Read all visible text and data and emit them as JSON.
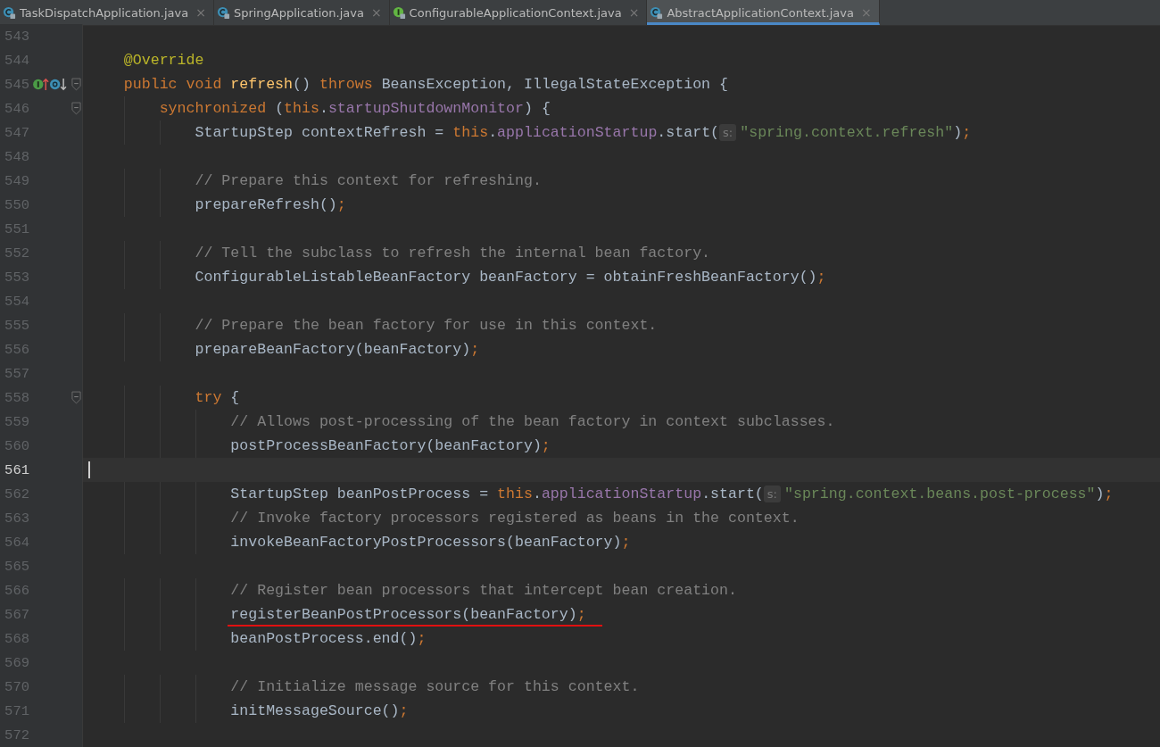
{
  "tabs": [
    {
      "label": "TaskDispatchApplication.java",
      "kind": "class",
      "selected": false
    },
    {
      "label": "SpringApplication.java",
      "kind": "class",
      "selected": false
    },
    {
      "label": "ConfigurableApplicationContext.java",
      "kind": "interface",
      "selected": false
    },
    {
      "label": "AbstractApplicationContext.java",
      "kind": "class",
      "selected": true
    }
  ],
  "close_glyph": "×",
  "lines": [
    {
      "number": "543",
      "current": false,
      "fold": false,
      "gutter_marks": false,
      "underlined": false
    },
    {
      "number": "544",
      "tokens": [
        {
          "kind": "annotation",
          "text": "    @Override"
        }
      ],
      "current": false,
      "fold": false,
      "gutter_marks": false,
      "underlined": false
    },
    {
      "number": "545",
      "tokens": [
        {
          "kind": "keyword",
          "text": "    public void "
        },
        {
          "kind": "method",
          "text": "refresh"
        },
        {
          "kind": "plain",
          "text": "() "
        },
        {
          "kind": "keyword",
          "text": "throws "
        },
        {
          "kind": "plain",
          "text": "BeansException, IllegalStateException {"
        }
      ],
      "current": false,
      "fold": true,
      "gutter_marks": true,
      "underlined": false
    },
    {
      "number": "546",
      "tokens": [
        {
          "kind": "keyword",
          "text": "        synchronized "
        },
        {
          "kind": "plain",
          "text": "("
        },
        {
          "kind": "keyword",
          "text": "this"
        },
        {
          "kind": "plain",
          "text": "."
        },
        {
          "kind": "field",
          "text": "startupShutdownMonitor"
        },
        {
          "kind": "plain",
          "text": ") {"
        }
      ],
      "current": false,
      "fold": true,
      "gutter_marks": false,
      "underlined": false
    },
    {
      "number": "547",
      "tokens": [
        {
          "kind": "plain",
          "text": "            StartupStep contextRefresh = "
        },
        {
          "kind": "keyword",
          "text": "this"
        },
        {
          "kind": "plain",
          "text": "."
        },
        {
          "kind": "field",
          "text": "applicationStartup"
        },
        {
          "kind": "plain",
          "text": ".start("
        },
        {
          "kind": "hint",
          "text": "s:"
        },
        {
          "kind": "string",
          "text": "\"spring.context.refresh\""
        },
        {
          "kind": "plain",
          "text": ")"
        },
        {
          "kind": "keyword",
          "text": ";"
        }
      ],
      "current": false,
      "fold": false,
      "gutter_marks": false,
      "underlined": false
    },
    {
      "number": "548",
      "current": false,
      "fold": false,
      "gutter_marks": false,
      "underlined": false
    },
    {
      "number": "549",
      "tokens": [
        {
          "kind": "comment",
          "text": "            // Prepare this context for refreshing."
        }
      ],
      "current": false,
      "fold": false,
      "gutter_marks": false,
      "underlined": false
    },
    {
      "number": "550",
      "tokens": [
        {
          "kind": "plain",
          "text": "            prepareRefresh()"
        },
        {
          "kind": "keyword",
          "text": ";"
        }
      ],
      "current": false,
      "fold": false,
      "gutter_marks": false,
      "underlined": false
    },
    {
      "number": "551",
      "current": false,
      "fold": false,
      "gutter_marks": false,
      "underlined": false
    },
    {
      "number": "552",
      "tokens": [
        {
          "kind": "comment",
          "text": "            // Tell the subclass to refresh the internal bean factory."
        }
      ],
      "current": false,
      "fold": false,
      "gutter_marks": false,
      "underlined": false
    },
    {
      "number": "553",
      "tokens": [
        {
          "kind": "plain",
          "text": "            ConfigurableListableBeanFactory beanFactory = obtainFreshBeanFactory()"
        },
        {
          "kind": "keyword",
          "text": ";"
        }
      ],
      "current": false,
      "fold": false,
      "gutter_marks": false,
      "underlined": false
    },
    {
      "number": "554",
      "current": false,
      "fold": false,
      "gutter_marks": false,
      "underlined": false
    },
    {
      "number": "555",
      "tokens": [
        {
          "kind": "comment",
          "text": "            // Prepare the bean factory for use in this context."
        }
      ],
      "current": false,
      "fold": false,
      "gutter_marks": false,
      "underlined": false
    },
    {
      "number": "556",
      "tokens": [
        {
          "kind": "plain",
          "text": "            prepareBeanFactory(beanFactory)"
        },
        {
          "kind": "keyword",
          "text": ";"
        }
      ],
      "current": false,
      "fold": false,
      "gutter_marks": false,
      "underlined": false
    },
    {
      "number": "557",
      "current": false,
      "fold": false,
      "gutter_marks": false,
      "underlined": false
    },
    {
      "number": "558",
      "tokens": [
        {
          "kind": "keyword",
          "text": "            try "
        },
        {
          "kind": "plain",
          "text": "{"
        }
      ],
      "current": false,
      "fold": true,
      "gutter_marks": false,
      "underlined": false
    },
    {
      "number": "559",
      "tokens": [
        {
          "kind": "comment",
          "text": "                // Allows post-processing of the bean factory in context subclasses."
        }
      ],
      "current": false,
      "fold": false,
      "gutter_marks": false,
      "underlined": false
    },
    {
      "number": "560",
      "tokens": [
        {
          "kind": "plain",
          "text": "                postProcessBeanFactory(beanFactory)"
        },
        {
          "kind": "keyword",
          "text": ";"
        }
      ],
      "current": false,
      "fold": false,
      "gutter_marks": false,
      "underlined": false
    },
    {
      "number": "561",
      "current": true,
      "fold": false,
      "gutter_marks": false,
      "underlined": false
    },
    {
      "number": "562",
      "tokens": [
        {
          "kind": "plain",
          "text": "                StartupStep beanPostProcess = "
        },
        {
          "kind": "keyword",
          "text": "this"
        },
        {
          "kind": "plain",
          "text": "."
        },
        {
          "kind": "field",
          "text": "applicationStartup"
        },
        {
          "kind": "plain",
          "text": ".start("
        },
        {
          "kind": "hint",
          "text": "s:"
        },
        {
          "kind": "string",
          "text": "\"spring.context.beans.post-process\""
        },
        {
          "kind": "plain",
          "text": ")"
        },
        {
          "kind": "keyword",
          "text": ";"
        }
      ],
      "current": false,
      "fold": false,
      "gutter_marks": false,
      "underlined": false
    },
    {
      "number": "563",
      "tokens": [
        {
          "kind": "comment",
          "text": "                // Invoke factory processors registered as beans in the context."
        }
      ],
      "current": false,
      "fold": false,
      "gutter_marks": false,
      "underlined": false
    },
    {
      "number": "564",
      "tokens": [
        {
          "kind": "plain",
          "text": "                invokeBeanFactoryPostProcessors(beanFactory)"
        },
        {
          "kind": "keyword",
          "text": ";"
        }
      ],
      "current": false,
      "fold": false,
      "gutter_marks": false,
      "underlined": false
    },
    {
      "number": "565",
      "current": false,
      "fold": false,
      "gutter_marks": false,
      "underlined": false
    },
    {
      "number": "566",
      "tokens": [
        {
          "kind": "comment",
          "text": "                // Register bean processors that intercept bean creation."
        }
      ],
      "current": false,
      "fold": false,
      "gutter_marks": false,
      "underlined": false
    },
    {
      "number": "567",
      "tokens": [
        {
          "kind": "plain",
          "text": "                registerBeanPostProcessors(beanFactory)"
        },
        {
          "kind": "keyword",
          "text": ";"
        }
      ],
      "current": false,
      "fold": false,
      "gutter_marks": false,
      "underlined": true
    },
    {
      "number": "568",
      "tokens": [
        {
          "kind": "plain",
          "text": "                beanPostProcess.end()"
        },
        {
          "kind": "keyword",
          "text": ";"
        }
      ],
      "current": false,
      "fold": false,
      "gutter_marks": false,
      "underlined": false
    },
    {
      "number": "569",
      "current": false,
      "fold": false,
      "gutter_marks": false,
      "underlined": false
    },
    {
      "number": "570",
      "tokens": [
        {
          "kind": "comment",
          "text": "                // Initialize message source for this context."
        }
      ],
      "current": false,
      "fold": false,
      "gutter_marks": false,
      "underlined": false
    },
    {
      "number": "571",
      "tokens": [
        {
          "kind": "plain",
          "text": "                initMessageSource()"
        },
        {
          "kind": "keyword",
          "text": ";"
        }
      ],
      "current": false,
      "fold": false,
      "gutter_marks": false,
      "underlined": false
    },
    {
      "number": "572",
      "current": false,
      "fold": false,
      "gutter_marks": false,
      "underlined": false
    }
  ]
}
